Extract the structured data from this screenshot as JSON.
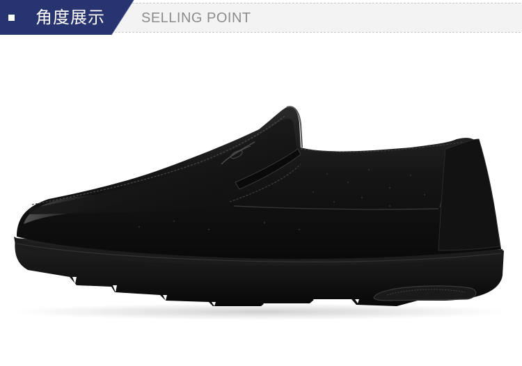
{
  "header": {
    "title_cn": "角度展示",
    "title_en": "SELLING POINT",
    "bullet_icon": "square-bullet-icon",
    "colors": {
      "banner_navy": "#28346f",
      "dashed_line": "#c9c9c9",
      "en_text": "#8c8c8c"
    }
  },
  "product": {
    "icon": "slip-on-leather-shoe-image",
    "colors": {
      "leather": "#141414",
      "sole": "#0d0d0d"
    }
  }
}
